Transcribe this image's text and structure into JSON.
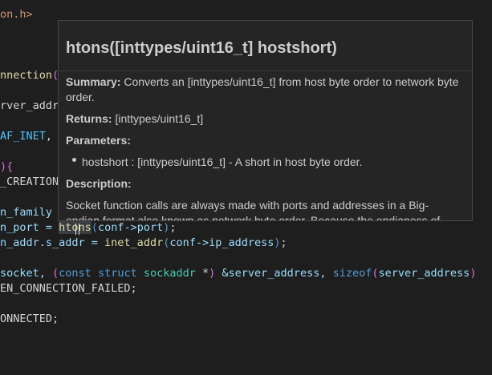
{
  "editor": {
    "l1": {
      "text": "on.h>"
    },
    "l2": {
      "fn": "nnection",
      "paren": "("
    },
    "l3": {
      "text": "rver_addr"
    },
    "l4": {
      "enum": "AF_INET",
      "rest": ","
    },
    "l5": {
      "paren": ")",
      "brace": "{"
    },
    "l6": {
      "text": "_CREATION"
    },
    "l7": {
      "text": "n_family"
    },
    "l8": {
      "a": "n_port = ",
      "fn": "htons",
      "p1": "(",
      "b": "conf->port",
      "p2": ")",
      "c": ";"
    },
    "l9": {
      "a": "n_addr.s_addr = ",
      "fn": "inet_addr",
      "p1": "(",
      "b": "conf->ip_address",
      "p2": ")",
      "c": ";"
    },
    "l10": {
      "a": "socket, ",
      "p1": "(",
      "kw": "const struct",
      "b": " sockaddr ",
      "op": "*",
      "p2": ")",
      "c": " &server_address, ",
      "fn": "sizeof",
      "p3": "(",
      "d": "server_address",
      "p4": ")"
    },
    "l11": {
      "text": "EN_CONNECTION_FAILED;"
    },
    "l12": {
      "text": "ONNECTED;"
    }
  },
  "hover": {
    "title": "htons([inttypes/uint16_t] hostshort)",
    "summary_label": "Summary:",
    "summary_text": " Converts an [inttypes/uint16_t] from host byte order to network byte order.",
    "returns_label": "Returns:",
    "returns_text": " [inttypes/uint16_t]",
    "parameters_label": "Parameters:",
    "param_item": "hostshort : [inttypes/uint16_t] - A short in host byte order.",
    "description_label": "Description:",
    "description_text": "Socket function calls are always made with ports and addresses in a Big-endian format also known as network byte order. Because the endianess of"
  }
}
